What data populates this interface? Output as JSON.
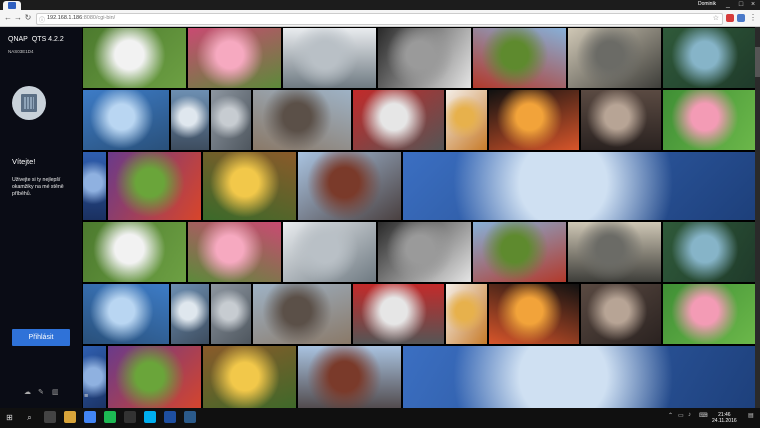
{
  "browser": {
    "profile_name": "Dominik",
    "window_controls": {
      "minimize": "_",
      "maximize": "□",
      "close": "×"
    },
    "nav": {
      "back": "←",
      "forward": "→",
      "reload": "↻"
    },
    "url_host": "192.168.1.186",
    "url_path": ":8080/cgi-bin/",
    "star_icon": "☆"
  },
  "sidebar": {
    "brand": "QNAP",
    "version": "QTS 4.2.2",
    "device_name": "NAS03E1D4",
    "welcome_title": "Vítejte!",
    "welcome_text": "Uživejte si ty nejlepší okamžiky na mé stěně příběhů.",
    "login_button": "Přihlásit",
    "footer_icons": [
      "cloud-icon",
      "tools-icon",
      "book-icon"
    ],
    "menu_icon": "≡"
  },
  "taskbar": {
    "start_icon": "windows-start-icon",
    "search_icon": "⌕",
    "clock_time": "21:46",
    "clock_date": "24.11.2016",
    "apps": [
      {
        "name": "task-view-icon",
        "color": "#444"
      },
      {
        "name": "explorer-icon",
        "color": "#d9a53a"
      },
      {
        "name": "chrome-icon",
        "color": "#4285f4"
      },
      {
        "name": "spotify-icon",
        "color": "#1db954"
      },
      {
        "name": "terminal-icon",
        "color": "#333"
      },
      {
        "name": "skype-icon",
        "color": "#00aff0"
      },
      {
        "name": "app-blue-icon",
        "color": "#1e4fa0"
      },
      {
        "name": "app-dark-blue-icon",
        "color": "#2b5a8a"
      }
    ]
  },
  "gallery": {
    "photos": [
      {
        "subject": "white-flower",
        "colors": [
          "#4c7a2e",
          "#f2f2f2",
          "#6da043"
        ]
      },
      {
        "subject": "pink-flowers",
        "colors": [
          "#c94a72",
          "#f6a9c0",
          "#5c8a3a"
        ]
      },
      {
        "subject": "pier-lake",
        "colors": [
          "#e9ecef",
          "#b9c0c6",
          "#6f7a82"
        ]
      },
      {
        "subject": "bw-seascape",
        "colors": [
          "#2a2a2a",
          "#9a9a9a",
          "#e5e5e5"
        ]
      },
      {
        "subject": "tractor-field",
        "colors": [
          "#87b0d8",
          "#5e8a2e",
          "#b2392b"
        ]
      },
      {
        "subject": "parking-lot",
        "colors": [
          "#cfc7b5",
          "#6b6b66",
          "#3e3e3a"
        ]
      },
      {
        "subject": "aerial-river",
        "colors": [
          "#2f5a3a",
          "#86b4c8",
          "#1f3a2a"
        ]
      },
      {
        "subject": "lake-houses",
        "colors": [
          "#3d7cc7",
          "#b9d6f2",
          "#29507a"
        ]
      },
      {
        "subject": "harbor-boats",
        "colors": [
          "#6d8fb2",
          "#dfe7ee",
          "#3d4c5e"
        ]
      },
      {
        "subject": "street-road",
        "colors": [
          "#8d96a0",
          "#c7ccd1",
          "#4e565e"
        ]
      },
      {
        "subject": "canal-warehouses",
        "colors": [
          "#9eb2c5",
          "#5b5048",
          "#8a7968"
        ]
      },
      {
        "subject": "race-car",
        "colors": [
          "#c32a2a",
          "#e6e6e6",
          "#555"
        ]
      },
      {
        "subject": "ice-cream",
        "colors": [
          "#f4eee8",
          "#e7b14c",
          "#c77b2a"
        ]
      },
      {
        "subject": "carousel-night",
        "colors": [
          "#111",
          "#f2a33a",
          "#d8552a"
        ]
      },
      {
        "subject": "city-rain",
        "colors": [
          "#5a4a42",
          "#b7a495",
          "#2a2220"
        ]
      },
      {
        "subject": "pink-rose",
        "colors": [
          "#3f8f35",
          "#f39bb5",
          "#6cb84a"
        ]
      },
      {
        "subject": "blue-sky",
        "colors": [
          "#2f5fb0",
          "#8fb1e0",
          "#1a3060"
        ]
      },
      {
        "subject": "vegetables",
        "colors": [
          "#6a3a8a",
          "#6aa53a",
          "#d8452a"
        ]
      },
      {
        "subject": "food-plate",
        "colors": [
          "#8a5a2a",
          "#f2c84a",
          "#3a6a2a"
        ]
      },
      {
        "subject": "warehouse-canal",
        "colors": [
          "#a9c3e0",
          "#7a3a2a",
          "#4a4040"
        ]
      },
      {
        "subject": "panorama-coast",
        "colors": [
          "#3b6fc2",
          "#cfe0f2",
          "#1d3f7a"
        ]
      }
    ]
  }
}
